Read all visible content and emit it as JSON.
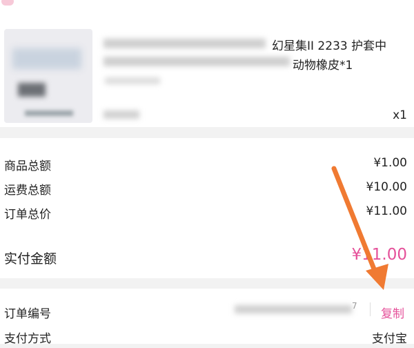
{
  "product": {
    "title_line1": "幻星集II 2233 护套中",
    "title_line2": "动物橡皮*1",
    "quantity": "x1"
  },
  "amounts": [
    {
      "label": "商品总额",
      "value": "¥1.00"
    },
    {
      "label": "运费总额",
      "value": "¥10.00"
    },
    {
      "label": "订单总价",
      "value": "¥11.00"
    }
  ],
  "paid": {
    "label": "实付金额",
    "value": "¥11.00"
  },
  "order_info": {
    "order_no_label": "订单编号",
    "order_no_tail": "7",
    "copy_label": "复制",
    "pay_method_label": "支付方式",
    "pay_method_value": "支付宝"
  },
  "colors": {
    "accent": "#e5519a",
    "annotation_arrow": "#f07a32"
  }
}
